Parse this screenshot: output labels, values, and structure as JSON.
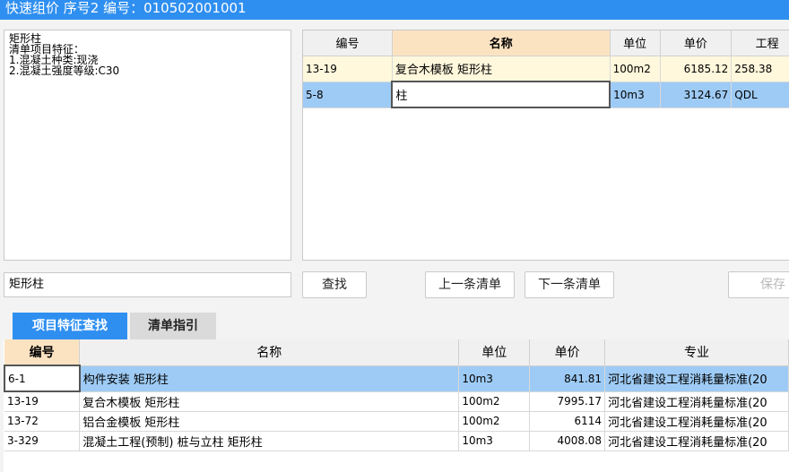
{
  "window": {
    "title": "快速组价 序号2 编号：010502001001"
  },
  "feature_text": "矩形柱\n清单项目特征：\n1.混凝土种类:现浇\n2.混凝土强度等级:C30",
  "top_grid": {
    "columns": [
      "编号",
      "名称",
      "单位",
      "单价",
      "工程"
    ],
    "rows": [
      {
        "code": "13-19",
        "name": "复合木模板 矩形柱",
        "unit": "100m2",
        "price": "6185.12",
        "qty": "258.38"
      },
      {
        "code": "5-8",
        "name": "柱",
        "unit": "10m3",
        "price": "3124.67",
        "qty": "QDL"
      }
    ]
  },
  "search": {
    "value": "矩形柱"
  },
  "buttons": {
    "find": "查找",
    "prev": "上一条清单",
    "next": "下一条清单",
    "save": "保存"
  },
  "tabs": {
    "feature_search": "项目特征查找",
    "list_guide": "清单指引"
  },
  "bottom_grid": {
    "columns": [
      "编号",
      "名称",
      "单位",
      "单价",
      "专业"
    ],
    "rows": [
      {
        "code": "6-1",
        "name": "构件安装 矩形柱",
        "unit": "10m3",
        "price": "841.81",
        "spec": "河北省建设工程消耗量标准(20"
      },
      {
        "code": "13-19",
        "name": "复合木模板 矩形柱",
        "unit": "100m2",
        "price": "7995.17",
        "spec": "河北省建设工程消耗量标准(20"
      },
      {
        "code": "13-72",
        "name": "铝合金模板 矩形柱",
        "unit": "100m2",
        "price": "6114",
        "spec": "河北省建设工程消耗量标准(20"
      },
      {
        "code": "3-329",
        "name": "混凝土工程(预制) 桩与立柱 矩形柱",
        "unit": "10m3",
        "price": "4008.08",
        "spec": "河北省建设工程消耗量标准(20"
      }
    ]
  }
}
